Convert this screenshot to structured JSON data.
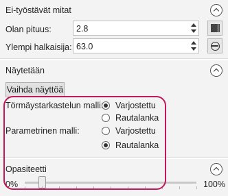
{
  "sections": {
    "dimensions": {
      "title": "Ei-työstävät mitat",
      "length_label": "Olan pituus:",
      "length_value": "2.8",
      "diameter_label": "Ylempi halkaisija:",
      "diameter_value": "63.0"
    },
    "display": {
      "title": "Näytetään",
      "switch_view_button": "Vaihda näyttöä",
      "collision_model_label": "Törmäystarkastelun malli:",
      "parametric_model_label": "Parametrinen malli:",
      "collision_options": [
        {
          "label": "Varjostettu",
          "checked": true
        },
        {
          "label": "Rautalanka",
          "checked": false
        }
      ],
      "parametric_options": [
        {
          "label": "Varjostettu",
          "checked": false
        },
        {
          "label": "Rautalanka",
          "checked": true
        }
      ]
    },
    "opacity": {
      "title": "Opasiteetti",
      "min_label": "0%",
      "max_label": "100%",
      "value_percent": 10
    }
  },
  "colors": {
    "highlight": "#c2185b",
    "panel_bg": "#f3f3f3"
  },
  "icons": {
    "collapse": "chevron-up-icon",
    "length_tool": "measure-rect-icon",
    "diameter_tool": "diameter-circle-icon"
  }
}
